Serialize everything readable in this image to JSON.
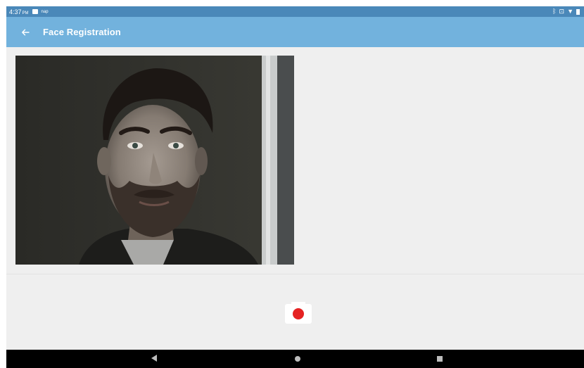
{
  "status_bar": {
    "time": "4:37",
    "ampm": "PM",
    "notification_icons": [
      "image-icon",
      "nap-icon"
    ],
    "right_icons": [
      "bluetooth-icon",
      "vibrate-icon",
      "wifi-icon",
      "battery-icon"
    ]
  },
  "app_bar": {
    "title": "Face Registration",
    "back_icon": "arrow-left-icon",
    "background_color": "#72b2dd"
  },
  "camera": {
    "capture_button_icon": "camera-record-icon",
    "record_color": "#e52222"
  },
  "navigation": {
    "buttons": [
      "back",
      "home",
      "recents"
    ]
  }
}
